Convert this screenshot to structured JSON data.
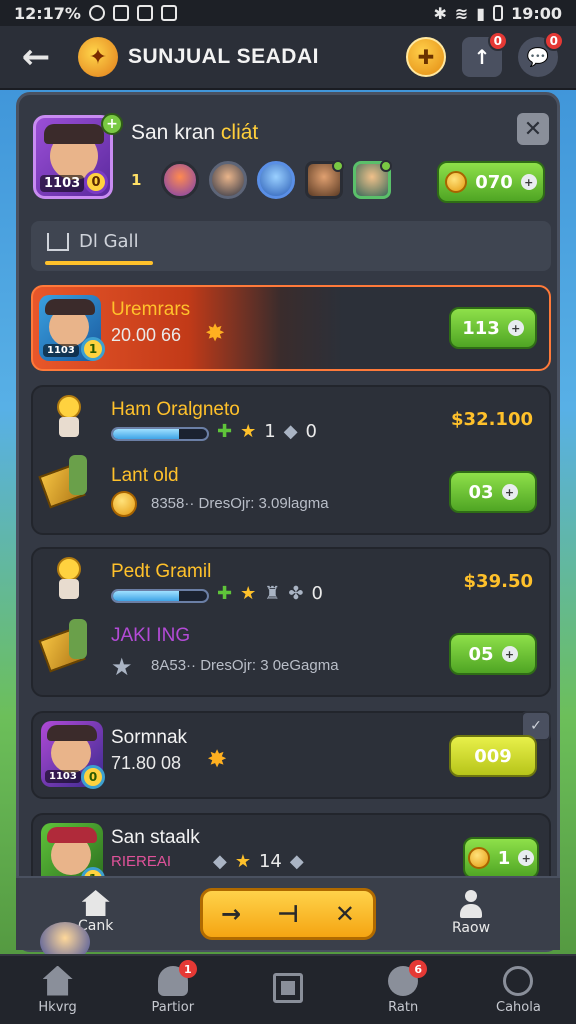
{
  "status_bar": {
    "left_time": "12:17%",
    "right_time": "19:00"
  },
  "header": {
    "title": "SUNJUAL SEADAI",
    "badge_a": "0",
    "badge_b": "0"
  },
  "profile": {
    "name_main": "San kran",
    "name_accent": "cliát",
    "level_text": "1103",
    "coin_badge": "0",
    "friend_count": "1",
    "gold_button": "070"
  },
  "tab": {
    "label": "Dl Gall"
  },
  "list": [
    {
      "name": "Uremrars",
      "sub": "20.00 66",
      "button": "113",
      "coin_badge": "1",
      "level_text": "1103"
    },
    {
      "name": "Ham Oralgneto",
      "price": "$32.100",
      "progress": 0.7,
      "stats_a": "1",
      "stats_b": "0",
      "item_name": "Lant old",
      "detail": "8358·· DresOjr: 3.09lagma",
      "button": "03"
    },
    {
      "name": "Pedt Gramil",
      "price": "$39.50",
      "progress": 0.7,
      "stats_b": "0",
      "item_name": "JAKI ING",
      "detail": "8A53·· DresOjr: 3 0eGagma",
      "button": "05"
    },
    {
      "name": "Sormnak",
      "sub": "71.80 08",
      "button": "009",
      "coin_badge": "0",
      "level_text": "1103"
    },
    {
      "name": "San staalk",
      "sub_label": "RIEREAI",
      "stat_num": "14",
      "button": "1",
      "coin_badge": "1"
    }
  ],
  "action_strip": {
    "left_label": "Cank",
    "right_label": "Raow",
    "controls": [
      "→",
      "⊣",
      "✕"
    ]
  },
  "bottom_nav": [
    {
      "label": "Hkvrg"
    },
    {
      "label": "Partior",
      "badge": "1"
    },
    {
      "label": ""
    },
    {
      "label": "Ratn",
      "badge": "6"
    },
    {
      "label": "Cahola"
    }
  ],
  "colors": {
    "accent": "#ffc12b",
    "green": "#5fb52c",
    "panel": "#343944"
  }
}
